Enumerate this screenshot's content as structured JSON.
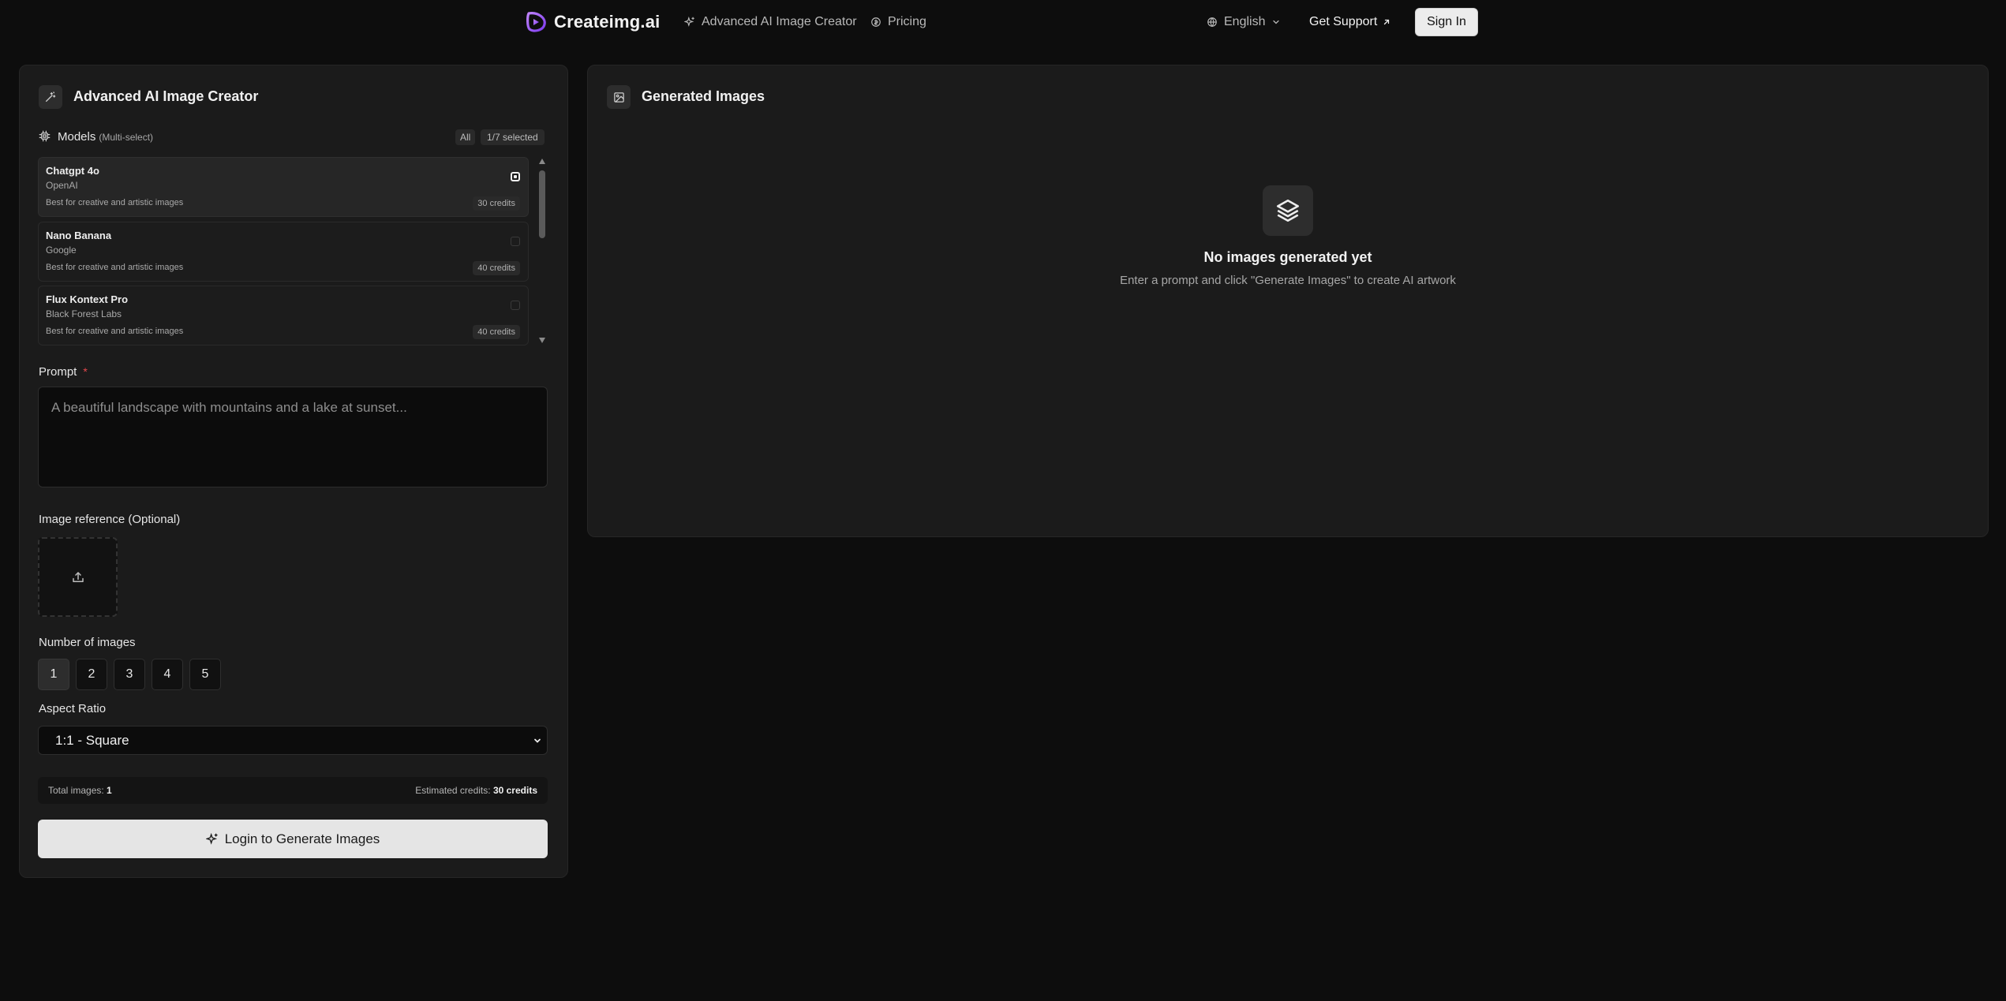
{
  "header": {
    "logo_text": "Createimg.ai",
    "nav": [
      {
        "label": "Advanced AI Image Creator"
      },
      {
        "label": "Pricing"
      }
    ],
    "language": "English",
    "support_label": "Get Support",
    "signin_label": "Sign In"
  },
  "creator": {
    "title": "Advanced AI Image Creator",
    "models_label": "Models",
    "models_hint": "(Multi-select)",
    "all_chip": "All",
    "selected_chip": "1/7 selected",
    "models": [
      {
        "name": "Chatgpt 4o",
        "provider": "OpenAI",
        "desc": "Best for creative and artistic images",
        "credits": "30 credits",
        "selected": true
      },
      {
        "name": "Nano Banana",
        "provider": "Google",
        "desc": "Best for creative and artistic images",
        "credits": "40 credits",
        "selected": false
      },
      {
        "name": "Flux Kontext Pro",
        "provider": "Black Forest Labs",
        "desc": "Best for creative and artistic images",
        "credits": "40 credits",
        "selected": false
      }
    ],
    "prompt_label": "Prompt",
    "prompt_required": "*",
    "prompt_placeholder": "A beautiful landscape with mountains and a lake at sunset...",
    "reference_label": "Image reference (Optional)",
    "count_label": "Number of images",
    "counts": [
      "1",
      "2",
      "3",
      "4",
      "5"
    ],
    "aspect_label": "Aspect Ratio",
    "aspect_value": "1:1 - Square",
    "total_label": "Total images:",
    "total_value": "1",
    "credits_label": "Estimated credits:",
    "credits_value": "30 credits",
    "generate_label": "Login to Generate Images"
  },
  "results": {
    "title": "Generated Images",
    "empty_title": "No images generated yet",
    "empty_sub": "Enter a prompt and click \"Generate Images\" to create AI artwork"
  },
  "colors": {
    "background": "#0d0d0d",
    "panel": "#1b1b1b",
    "accent": "#9b5cf6",
    "required": "#e5484d"
  }
}
